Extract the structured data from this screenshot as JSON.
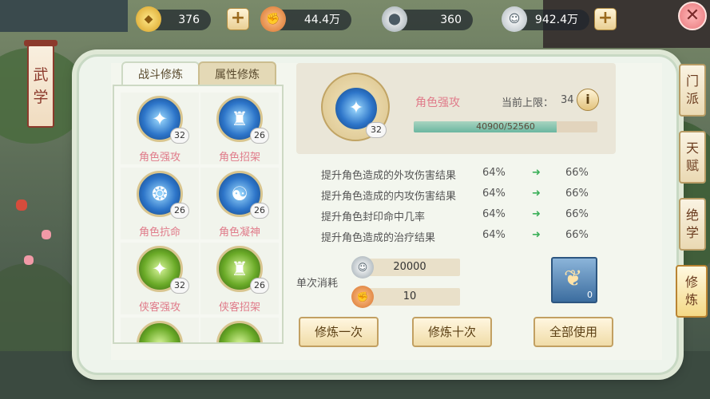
{
  "currencies": [
    {
      "icon": "gold-ingot-icon",
      "value": "376"
    },
    {
      "icon": "copper-coin-icon",
      "value": "44.4万"
    },
    {
      "icon": "silver-coin-icon",
      "value": "360"
    },
    {
      "icon": "silver-coin-large-icon",
      "value": "942.4万"
    }
  ],
  "panel": {
    "title_chars": [
      "武",
      "学"
    ],
    "tabs": [
      "战斗修炼",
      "属性修炼"
    ],
    "skills": [
      {
        "name": "角色强攻",
        "level": "32",
        "color": "blue",
        "glyph": "✦"
      },
      {
        "name": "角色招架",
        "level": "26",
        "color": "blue",
        "glyph": "♜"
      },
      {
        "name": "角色抗命",
        "level": "26",
        "color": "blue",
        "glyph": "❂"
      },
      {
        "name": "角色凝神",
        "level": "26",
        "color": "blue",
        "glyph": "☯"
      },
      {
        "name": "侠客强攻",
        "level": "32",
        "color": "green",
        "glyph": "✦"
      },
      {
        "name": "侠客招架",
        "level": "26",
        "color": "green",
        "glyph": "♜"
      },
      {
        "name": "",
        "level": "",
        "color": "green",
        "glyph": ""
      },
      {
        "name": "",
        "level": "",
        "color": "green",
        "glyph": ""
      }
    ]
  },
  "detail": {
    "skill_name": "角色强攻",
    "level": "32",
    "limit_label": "当前上限：",
    "limit_value": "34",
    "xp_text": "40900/52560",
    "xp_progress": 0.778,
    "stats": [
      {
        "desc": "提升角色造成的外攻伤害结果",
        "current": "64%",
        "next": "66%"
      },
      {
        "desc": "提升角色造成的内攻伤害结果",
        "current": "64%",
        "next": "66%"
      },
      {
        "desc": "提升角色封印命中几率",
        "current": "64%",
        "next": "66%"
      },
      {
        "desc": "提升角色造成的治疗结果",
        "current": "64%",
        "next": "66%"
      }
    ]
  },
  "cost": {
    "label": "单次消耗",
    "silver": "20000",
    "copper": "10",
    "item_count": "0"
  },
  "buttons": {
    "train_once": "修炼一次",
    "train_ten": "修炼十次",
    "use_all": "全部使用"
  },
  "side_tabs": [
    {
      "chars": [
        "门",
        "派"
      ],
      "active": false
    },
    {
      "chars": [
        "天",
        "赋"
      ],
      "active": false
    },
    {
      "chars": [
        "绝",
        "学"
      ],
      "active": false
    },
    {
      "chars": [
        "修",
        "炼"
      ],
      "active": true
    }
  ],
  "colors": {
    "accent_pink": "#e07b8a",
    "arrow_green": "#3db05a",
    "xp_fill": "#6bb6a0"
  }
}
